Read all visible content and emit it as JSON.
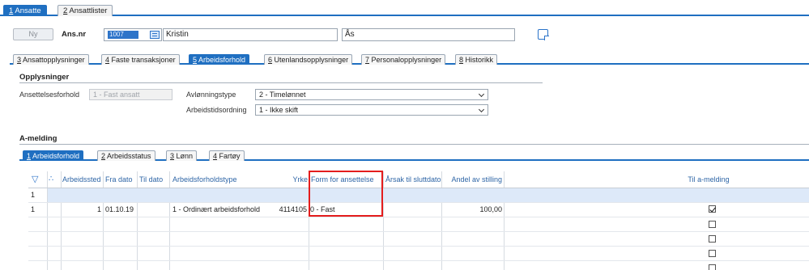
{
  "top_tabs": [
    {
      "num": "1",
      "label": "Ansatte"
    },
    {
      "num": "2",
      "label": "Ansattlister"
    }
  ],
  "header": {
    "new_button": "Ny",
    "ansnr_label": "Ans.nr",
    "ansnr_value": "1007",
    "first_name": "Kristin",
    "last_name": "Ås"
  },
  "mid_tabs": [
    {
      "num": "3",
      "label": "Ansattopplysninger"
    },
    {
      "num": "4",
      "label": "Faste transaksjoner"
    },
    {
      "num": "5",
      "label": "Arbeidsforhold"
    },
    {
      "num": "6",
      "label": "Utenlandsopplysninger"
    },
    {
      "num": "7",
      "label": "Personalopplysninger"
    },
    {
      "num": "8",
      "label": "Historikk"
    }
  ],
  "opplysninger": {
    "title": "Opplysninger",
    "ansettelsesforhold_label": "Ansettelsesforhold",
    "ansettelsesforhold_value": "1 - Fast ansatt",
    "avlonningstype_label": "Avlønningstype",
    "avlonningstype_value": "2 - Timelønnet",
    "arbeidstidsordning_label": "Arbeidstidsordning",
    "arbeidstidsordning_value": "1 - Ikke skift"
  },
  "amelding": {
    "title": "A-melding",
    "tabs": [
      {
        "num": "1",
        "label": "Arbeidsforhold"
      },
      {
        "num": "2",
        "label": "Arbeidsstatus"
      },
      {
        "num": "3",
        "label": "Lønn"
      },
      {
        "num": "4",
        "label": "Fartøy"
      }
    ],
    "columns": {
      "arbeidssted": "Arbeidssted",
      "fra_dato": "Fra dato",
      "til_dato": "Til dato",
      "type": "Arbeidsforholdstype",
      "yrke": "Yrke",
      "form": "Form for ansettelse",
      "arsak": "Årsak til sluttdato",
      "andel": "Andel av stilling",
      "til_amelding": "Til a-melding"
    },
    "filter_row_num": "1",
    "rows": [
      {
        "num": "1",
        "arbeidssted": "1",
        "fra_dato": "01.10.19",
        "til_dato": "",
        "type": "1 - Ordinært arbeidsforhold",
        "yrke": "4114105",
        "form": "0 - Fast",
        "arsak": "",
        "andel": "100,00",
        "til_amelding": true
      }
    ],
    "empty_rows": 4
  },
  "colors": {
    "accent": "#1f6fc1",
    "highlight": "#e41d1d",
    "header_text": "#2e65a6",
    "selected_row": "#dde9f9"
  }
}
